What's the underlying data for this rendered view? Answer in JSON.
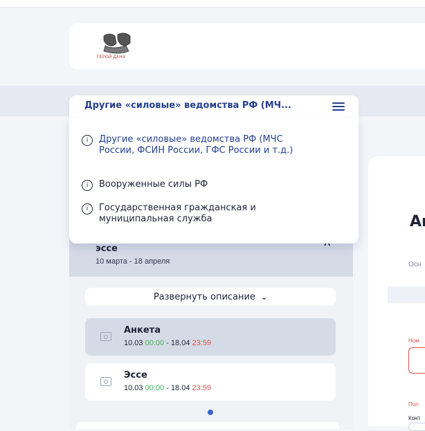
{
  "logo": {
    "text": "ГЕРОЙ ДАНА"
  },
  "select": {
    "title": "Другие «силовые» ведомства РФ (МЧ..."
  },
  "dropdown": {
    "options": [
      {
        "label": "Другие «силовые» ведомства РФ (МЧС России, ФСИН России, ГФС России и т.д.)",
        "icon": "info-icon",
        "selected": true
      },
      {
        "label": "Вооруженные силы РФ",
        "icon": "info-icon",
        "selected": false
      },
      {
        "label": "Государственная гражданская и муниципальная служба",
        "icon": "info-icon",
        "selected": false
      }
    ]
  },
  "stage": {
    "name": "эссе",
    "dates": "10 марта - 18 апреля"
  },
  "expand_label": "Развернуть описание",
  "tasks": [
    {
      "name": "Анкета",
      "date_start": "10.03",
      "time_start": "00:00",
      "sep": "-",
      "date_end": "18.04",
      "time_end": "23:59"
    },
    {
      "name": "Эссе",
      "date_start": "10.03",
      "time_start": "00:00",
      "sep": "-",
      "date_end": "18.04",
      "time_end": "23:59"
    }
  ],
  "main": {
    "title": "Ан",
    "tab": "Осн",
    "fields": [
      {
        "label": "Ном"
      },
      {
        "label": "Пол"
      },
      {
        "label": "Конт"
      }
    ]
  },
  "colors": {
    "accent": "#24408e",
    "green": "#44b35a",
    "red": "#e0524f"
  }
}
